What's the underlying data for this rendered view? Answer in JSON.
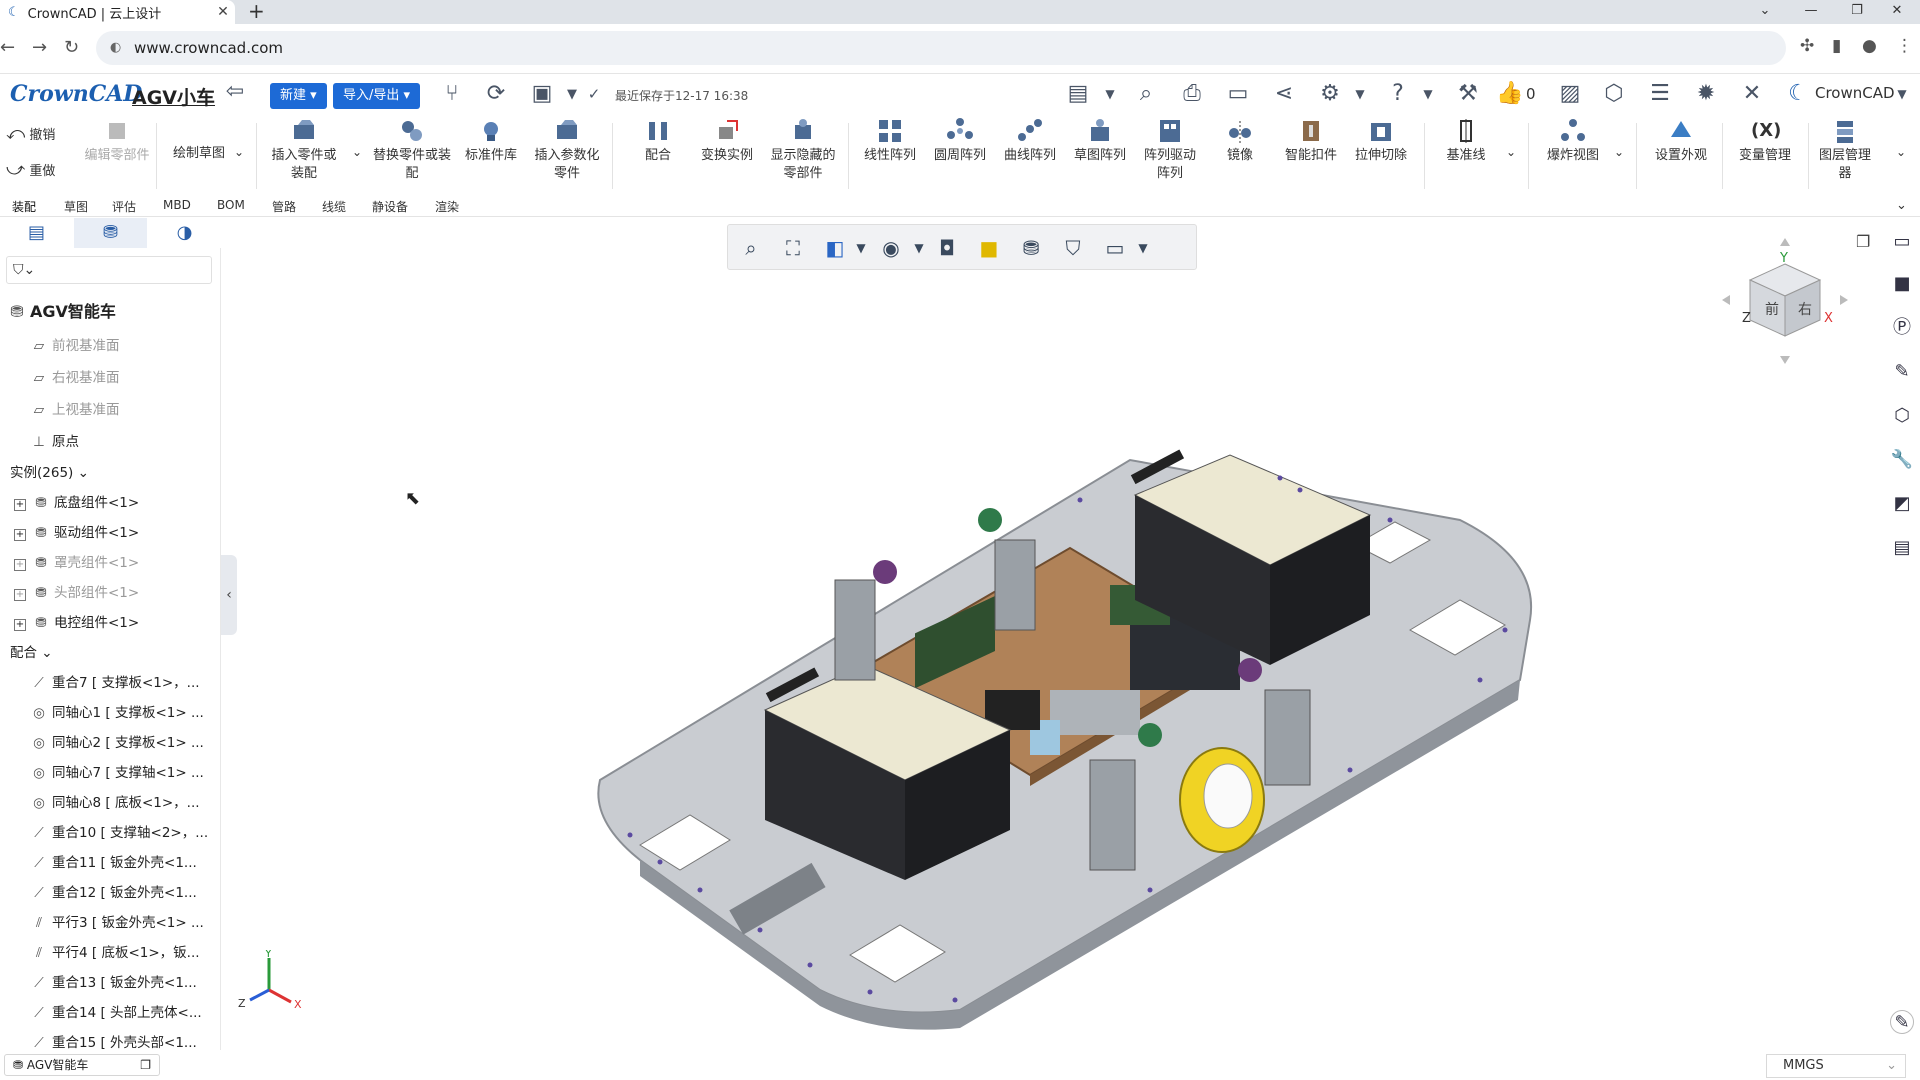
{
  "browser": {
    "tab_title": "CrownCAD | 云上设计",
    "url": "www.crowncad.com"
  },
  "app": {
    "logo": "CrownCAD",
    "doc_title": "AGV小车",
    "new_label": "新建",
    "import_export_label": "导入/导出",
    "saved_text": "最近保存于12-17 16:38",
    "like_count": "0",
    "user_label": "CrownCAD"
  },
  "ribbon": {
    "undo": "撤销",
    "redo": "重做",
    "edit_part": "编辑零部件",
    "draw_sketch": "绘制草图",
    "insert_part": "插入零件或装配",
    "replace_part": "替换零件或装配",
    "standard_lib": "标准件库",
    "insert_param_part": "插入参数化零件",
    "mate": "配合",
    "transform_instance": "变换实例",
    "show_hidden": "显示隐藏的零部件",
    "linear_pattern": "线性阵列",
    "circular_pattern": "圆周阵列",
    "curve_pattern": "曲线阵列",
    "sketch_pattern": "草图阵列",
    "pattern_driven": "阵列驱动阵列",
    "mirror": "镜像",
    "smart_fastener": "智能扣件",
    "extrude_cut": "拉伸切除",
    "datum_line": "基准线",
    "explode_view": "爆炸视图",
    "appearance": "设置外观",
    "variables": "变量管理",
    "layer_manager": "图层管理器"
  },
  "ribbon_tabs": [
    "装配",
    "草图",
    "评估",
    "MBD",
    "BOM",
    "管路",
    "线缆",
    "静设备",
    "渲染"
  ],
  "tree": {
    "root": "AGV智能车",
    "planes": [
      "前视基准面",
      "右视基准面",
      "上视基准面"
    ],
    "origin": "原点",
    "instances_label": "实例(265)",
    "components": [
      {
        "label": "底盘组件<1>",
        "dim": false
      },
      {
        "label": "驱动组件<1>",
        "dim": false
      },
      {
        "label": "罩壳组件<1>",
        "dim": true
      },
      {
        "label": "头部组件<1>",
        "dim": true
      },
      {
        "label": "电控组件<1>",
        "dim": false
      }
    ],
    "mates_label": "配合",
    "mates": [
      {
        "label": "重合7 [ 支撑板<1>，...",
        "icon": "coincident"
      },
      {
        "label": "同轴心1 [ 支撑板<1> ...",
        "icon": "concentric"
      },
      {
        "label": "同轴心2 [ 支撑板<1> ...",
        "icon": "concentric"
      },
      {
        "label": "同轴心7 [ 支撑轴<1> ...",
        "icon": "concentric"
      },
      {
        "label": "同轴心8 [ 底板<1>，...",
        "icon": "concentric"
      },
      {
        "label": "重合10 [ 支撑轴<2>，...",
        "icon": "coincident"
      },
      {
        "label": "重合11 [ 钣金外壳<1...",
        "icon": "coincident"
      },
      {
        "label": "重合12 [ 钣金外壳<1...",
        "icon": "coincident"
      },
      {
        "label": "平行3 [ 钣金外壳<1> ...",
        "icon": "parallel"
      },
      {
        "label": "平行4 [ 底板<1>，钣...",
        "icon": "parallel"
      },
      {
        "label": "重合13 [ 钣金外壳<1...",
        "icon": "coincident"
      },
      {
        "label": "重合14 [ 头部上壳体<...",
        "icon": "coincident"
      },
      {
        "label": "重合15 [ 外壳头部<1...",
        "icon": "coincident"
      }
    ]
  },
  "viewcube": {
    "front": "前",
    "right": "右",
    "x": "X",
    "y": "Y",
    "z": "Z"
  },
  "triad": {
    "x": "X",
    "y": "Y",
    "z": "Z"
  },
  "bottom": {
    "doc_tab": "AGV智能车",
    "units": "MMGS"
  },
  "colors": {
    "accent": "#1d6ad6",
    "plate": "#c9ccd1",
    "board": "#b08258",
    "battery": "#ece8d2",
    "wheel": "#f0d324"
  }
}
